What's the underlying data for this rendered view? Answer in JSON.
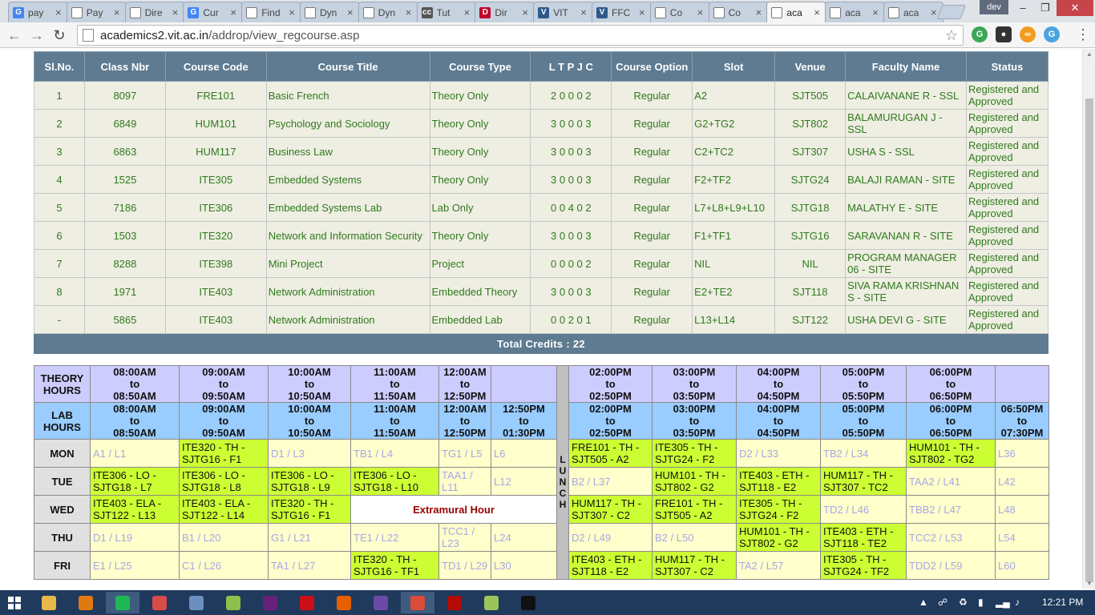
{
  "browser": {
    "tabs": [
      {
        "title": "pay",
        "icon": "google-icon",
        "color": "#4285f4",
        "glyph": "G"
      },
      {
        "title": "Pay",
        "icon": "page-icon",
        "color": "#ffffff",
        "glyph": ""
      },
      {
        "title": "Dire",
        "icon": "page-icon",
        "color": "#ffffff",
        "glyph": ""
      },
      {
        "title": "Cur",
        "icon": "google-icon",
        "color": "#4285f4",
        "glyph": "G"
      },
      {
        "title": "Find",
        "icon": "page-icon",
        "color": "#ffffff",
        "glyph": ""
      },
      {
        "title": "Dyn",
        "icon": "page-icon",
        "color": "#ffffff",
        "glyph": ""
      },
      {
        "title": "Dyn",
        "icon": "page-icon",
        "color": "#ffffff",
        "glyph": ""
      },
      {
        "title": "Tut",
        "icon": "cc-icon",
        "color": "#555555",
        "glyph": "cc"
      },
      {
        "title": "Dir",
        "icon": "d-icon",
        "color": "#c4002b",
        "glyph": "D"
      },
      {
        "title": "VIT",
        "icon": "vit-icon",
        "color": "#2c5a8c",
        "glyph": "V"
      },
      {
        "title": "FFC",
        "icon": "vit-icon",
        "color": "#2c5a8c",
        "glyph": "V"
      },
      {
        "title": "Co",
        "icon": "page-icon",
        "color": "#ffffff",
        "glyph": ""
      },
      {
        "title": "Co",
        "icon": "page-icon",
        "color": "#ffffff",
        "glyph": ""
      },
      {
        "title": "aca",
        "icon": "page-icon",
        "color": "#ffffff",
        "glyph": "",
        "active": true
      },
      {
        "title": "aca",
        "icon": "page-icon",
        "color": "#ffffff",
        "glyph": ""
      },
      {
        "title": "aca",
        "icon": "page-icon",
        "color": "#ffffff",
        "glyph": ""
      }
    ],
    "profile": "dev",
    "url_host": "academics2.vit.ac.in",
    "url_path": "/addrop/view_regcourse.asp"
  },
  "course_table": {
    "headers": [
      "Sl.No.",
      "Class Nbr",
      "Course Code",
      "Course Title",
      "Course Type",
      "L T P J C",
      "Course Option",
      "Slot",
      "Venue",
      "Faculty Name",
      "Status"
    ],
    "rows": [
      [
        "1",
        "8097",
        "FRE101",
        "Basic French",
        "Theory Only",
        "2 0 0 0 2",
        "Regular",
        "A2",
        "SJT505",
        "CALAIVANANE R - SSL",
        "Registered and Approved"
      ],
      [
        "2",
        "6849",
        "HUM101",
        "Psychology and Sociology",
        "Theory Only",
        "3 0 0 0 3",
        "Regular",
        "G2+TG2",
        "SJT802",
        "BALAMURUGAN J - SSL",
        "Registered and Approved"
      ],
      [
        "3",
        "6863",
        "HUM117",
        "Business Law",
        "Theory Only",
        "3 0 0 0 3",
        "Regular",
        "C2+TC2",
        "SJT307",
        "USHA S - SSL",
        "Registered and Approved"
      ],
      [
        "4",
        "1525",
        "ITE305",
        "Embedded Systems",
        "Theory Only",
        "3 0 0 0 3",
        "Regular",
        "F2+TF2",
        "SJTG24",
        "BALAJI RAMAN - SITE",
        "Registered and Approved"
      ],
      [
        "5",
        "7186",
        "ITE306",
        "Embedded Systems Lab",
        "Lab Only",
        "0 0 4 0 2",
        "Regular",
        "L7+L8+L9+L10",
        "SJTG18",
        "MALATHY E - SITE",
        "Registered and Approved"
      ],
      [
        "6",
        "1503",
        "ITE320",
        "Network and Information Security",
        "Theory Only",
        "3 0 0 0 3",
        "Regular",
        "F1+TF1",
        "SJTG16",
        "SARAVANAN R - SITE",
        "Registered and Approved"
      ],
      [
        "7",
        "8288",
        "ITE398",
        "Mini Project",
        "Project",
        "0 0 0 0 2",
        "Regular",
        "NIL",
        "NIL",
        "PROGRAM MANAGER 06 - SITE",
        "Registered and Approved"
      ],
      [
        "8",
        "1971",
        "ITE403",
        "Network Administration",
        "Embedded Theory",
        "3 0 0 0 3",
        "Regular",
        "E2+TE2",
        "SJT118",
        "SIVA RAMA KRISHNAN S - SITE",
        "Registered and Approved"
      ],
      [
        "-",
        "5865",
        "ITE403",
        "Network Administration",
        "Embedded Lab",
        "0 0 2 0 1",
        "Regular",
        "L13+L14",
        "SJT122",
        "USHA DEVI G - SITE",
        "Registered and Approved"
      ]
    ],
    "total_label": "Total Credits   :   22"
  },
  "timetable": {
    "theory_label": "THEORY HOURS",
    "lab_label": "LAB HOURS",
    "lunch": [
      "L",
      "U",
      "N",
      "C",
      "H"
    ],
    "theory_hours": [
      [
        "08:00AM",
        "to",
        "08:50AM"
      ],
      [
        "09:00AM",
        "to",
        "09:50AM"
      ],
      [
        "10:00AM",
        "to",
        "10:50AM"
      ],
      [
        "11:00AM",
        "to",
        "11:50AM"
      ],
      [
        "12:00AM",
        "to",
        "12:50PM"
      ],
      [
        "",
        "",
        ""
      ],
      [
        "02:00PM",
        "to",
        "02:50PM"
      ],
      [
        "03:00PM",
        "to",
        "03:50PM"
      ],
      [
        "04:00PM",
        "to",
        "04:50PM"
      ],
      [
        "05:00PM",
        "to",
        "05:50PM"
      ],
      [
        "06:00PM",
        "to",
        "06:50PM"
      ],
      [
        "",
        "",
        ""
      ]
    ],
    "lab_hours": [
      [
        "08:00AM",
        "to",
        "08:50AM"
      ],
      [
        "09:00AM",
        "to",
        "09:50AM"
      ],
      [
        "10:00AM",
        "to",
        "10:50AM"
      ],
      [
        "11:00AM",
        "to",
        "11:50AM"
      ],
      [
        "12:00AM",
        "to",
        "12:50PM"
      ],
      [
        "12:50PM",
        "to",
        "01:30PM"
      ],
      [
        "02:00PM",
        "to",
        "02:50PM"
      ],
      [
        "03:00PM",
        "to",
        "03:50PM"
      ],
      [
        "04:00PM",
        "to",
        "04:50PM"
      ],
      [
        "05:00PM",
        "to",
        "05:50PM"
      ],
      [
        "06:00PM",
        "to",
        "06:50PM"
      ],
      [
        "06:50PM",
        "to",
        "07:30PM"
      ]
    ],
    "days": [
      {
        "day": "MON",
        "cells": [
          {
            "t": "A1 / L1",
            "s": "free"
          },
          {
            "t": "ITE320 - TH - SJTG16 - F1",
            "s": "busy"
          },
          {
            "t": "D1 / L3",
            "s": "free"
          },
          {
            "t": "TB1 / L4",
            "s": "free"
          },
          {
            "t": "TG1 / L5",
            "s": "free"
          },
          {
            "t": "L6",
            "s": "free"
          },
          {
            "t": "FRE101 - TH - SJT505 - A2",
            "s": "busy"
          },
          {
            "t": "ITE305 - TH - SJTG24 - F2",
            "s": "busy"
          },
          {
            "t": "D2 / L33",
            "s": "free"
          },
          {
            "t": "TB2 / L34",
            "s": "free"
          },
          {
            "t": "HUM101 - TH - SJT802 - TG2",
            "s": "busy"
          },
          {
            "t": "L36",
            "s": "free"
          }
        ]
      },
      {
        "day": "TUE",
        "cells": [
          {
            "t": "ITE306 - LO - SJTG18 - L7",
            "s": "busy"
          },
          {
            "t": "ITE306 - LO - SJTG18 - L8",
            "s": "busy"
          },
          {
            "t": "ITE306 - LO - SJTG18 - L9",
            "s": "busy"
          },
          {
            "t": "ITE306 - LO - SJTG18 - L10",
            "s": "busy"
          },
          {
            "t": "TAA1 / L11",
            "s": "free"
          },
          {
            "t": "L12",
            "s": "free"
          },
          {
            "t": "B2 / L37",
            "s": "free"
          },
          {
            "t": "HUM101 - TH - SJT802 - G2",
            "s": "busy"
          },
          {
            "t": "ITE403 - ETH - SJT118 - E2",
            "s": "busy"
          },
          {
            "t": "HUM117 - TH - SJT307 - TC2",
            "s": "busy"
          },
          {
            "t": "TAA2 / L41",
            "s": "free"
          },
          {
            "t": "L42",
            "s": "free"
          }
        ]
      },
      {
        "day": "WED",
        "cells": [
          {
            "t": "ITE403 - ELA - SJT122 - L13",
            "s": "busy"
          },
          {
            "t": "ITE403 - ELA - SJT122 - L14",
            "s": "busy"
          },
          {
            "t": "ITE320 - TH - SJTG16 - F1",
            "s": "busy"
          },
          {
            "t": "Extramural Hour",
            "s": "extra",
            "span": 3
          },
          {
            "t": "HUM117 - TH - SJT307 - C2",
            "s": "busy"
          },
          {
            "t": "FRE101 - TH - SJT505 - A2",
            "s": "busy"
          },
          {
            "t": "ITE305 - TH - SJTG24 - F2",
            "s": "busy"
          },
          {
            "t": "TD2 / L46",
            "s": "free"
          },
          {
            "t": "TBB2 / L47",
            "s": "free"
          },
          {
            "t": "L48",
            "s": "free"
          }
        ]
      },
      {
        "day": "THU",
        "cells": [
          {
            "t": "D1 / L19",
            "s": "free"
          },
          {
            "t": "B1 / L20",
            "s": "free"
          },
          {
            "t": "G1 / L21",
            "s": "free"
          },
          {
            "t": "TE1 / L22",
            "s": "free"
          },
          {
            "t": "TCC1 / L23",
            "s": "free"
          },
          {
            "t": "L24",
            "s": "free"
          },
          {
            "t": "D2 / L49",
            "s": "free"
          },
          {
            "t": "B2 / L50",
            "s": "free"
          },
          {
            "t": "HUM101 - TH - SJT802 - G2",
            "s": "busy"
          },
          {
            "t": "ITE403 - ETH - SJT118 - TE2",
            "s": "busy"
          },
          {
            "t": "TCC2 / L53",
            "s": "free"
          },
          {
            "t": "L54",
            "s": "free"
          }
        ]
      },
      {
        "day": "FRI",
        "cells": [
          {
            "t": "E1 / L25",
            "s": "free"
          },
          {
            "t": "C1 / L26",
            "s": "free"
          },
          {
            "t": "TA1 / L27",
            "s": "free"
          },
          {
            "t": "ITE320 - TH - SJTG16 - TF1",
            "s": "busy"
          },
          {
            "t": "TD1 / L29",
            "s": "free"
          },
          {
            "t": "L30",
            "s": "free"
          },
          {
            "t": "ITE403 - ETH - SJT118 - E2",
            "s": "busy"
          },
          {
            "t": "HUM117 - TH - SJT307 - C2",
            "s": "busy"
          },
          {
            "t": "TA2 / L57",
            "s": "free"
          },
          {
            "t": "ITE305 - TH - SJTG24 - TF2",
            "s": "busy"
          },
          {
            "t": "TDD2 / L59",
            "s": "free"
          },
          {
            "t": "L60",
            "s": "free"
          }
        ]
      }
    ]
  },
  "taskbar": {
    "apps": [
      {
        "name": "file-explorer-icon",
        "color": "#e8b84a"
      },
      {
        "name": "media-player-icon",
        "color": "#e07a10"
      },
      {
        "name": "spotify-icon",
        "color": "#1db954",
        "on": true
      },
      {
        "name": "paint-icon",
        "color": "#d94a4a"
      },
      {
        "name": "calculator-icon",
        "color": "#6a8fc0"
      },
      {
        "name": "folder-sync-icon",
        "color": "#8cc04a"
      },
      {
        "name": "visual-studio-icon",
        "color": "#68217a"
      },
      {
        "name": "opera-icon",
        "color": "#cc0f16"
      },
      {
        "name": "firefox-icon",
        "color": "#e66000"
      },
      {
        "name": "visual-studio-code-icon",
        "color": "#6c4aa8"
      },
      {
        "name": "chrome-icon",
        "color": "#dd4b39",
        "on": true
      },
      {
        "name": "pdf-reader-icon",
        "color": "#b30b00"
      },
      {
        "name": "notepad-icon",
        "color": "#9bc45a"
      },
      {
        "name": "command-prompt-icon",
        "color": "#111111"
      }
    ],
    "clock": "12:21 PM"
  }
}
